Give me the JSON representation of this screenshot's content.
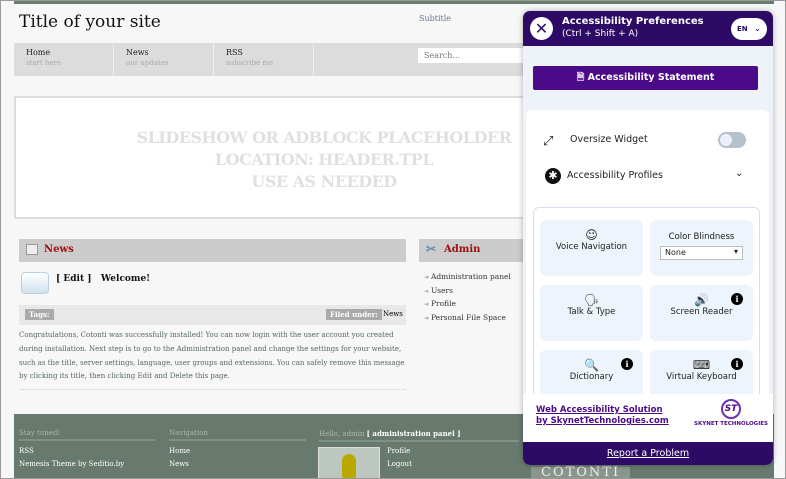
{
  "site": {
    "title": "Title of your site",
    "subtitle": "Subtitle",
    "search_placeholder": "Search...",
    "nav": [
      {
        "label": "Home",
        "sub": "start here"
      },
      {
        "label": "News",
        "sub": "our updates"
      },
      {
        "label": "RSS",
        "sub": "subscribe me"
      }
    ],
    "slideshow": [
      "SLIDESHOW OR ADBLOCK PLACEHOLDER",
      "LOCATION: HEADER.TPL",
      "USE AS NEEDED"
    ],
    "news": {
      "heading": "News",
      "edit": "[ Edit ]",
      "post_title": "Welcome!",
      "tags_label": "Tags:",
      "filed_label": "Filed under:",
      "filed_value": "News",
      "body": "Congratulations, Cotonti was successfully installed! You can now login with the user account you created during installation. Next step is to go to the Administration panel and change the settings for your website, such as the title, server settings, language, user groups and extensions. You can safely remove this message by clicking its title, then clicking Edit and Delete this page."
    },
    "admin": {
      "heading": "Admin",
      "items": [
        "Administration panel",
        "Users",
        "Profile",
        "Personal File Space"
      ]
    },
    "footer": {
      "stay": "Stay tuned!",
      "stay_items": [
        "RSS",
        "Nemesis Theme by Seditio.by"
      ],
      "nav": "Navigation",
      "nav_items": [
        "Home",
        "News"
      ],
      "hello": "Hello, admin",
      "admin_panel": "[ administration panel ]",
      "user_items": [
        "Profile",
        "Logout"
      ],
      "brand": "COTONTI"
    }
  },
  "widget": {
    "title": "Accessibility Preferences",
    "shortcut": "(Ctrl + Shift + A)",
    "lang": "EN",
    "statement": "Accessibility Statement",
    "oversize": "Oversize Widget",
    "oversize_on": false,
    "profiles": "Accessibility Profiles",
    "tiles": {
      "voice": "Voice Navigation",
      "color": "Color Blindness",
      "color_value": "None",
      "talk": "Talk & Type",
      "reader": "Screen Reader",
      "dictionary": "Dictionary",
      "keyboard": "Virtual Keyboard"
    },
    "footer_link": "Web Accessibility Solution by SkynetTechnologies.com",
    "logo_text": "SKYNET TECHNOLOGIES",
    "logo_mark": "ST",
    "report": "Report a Problem"
  }
}
